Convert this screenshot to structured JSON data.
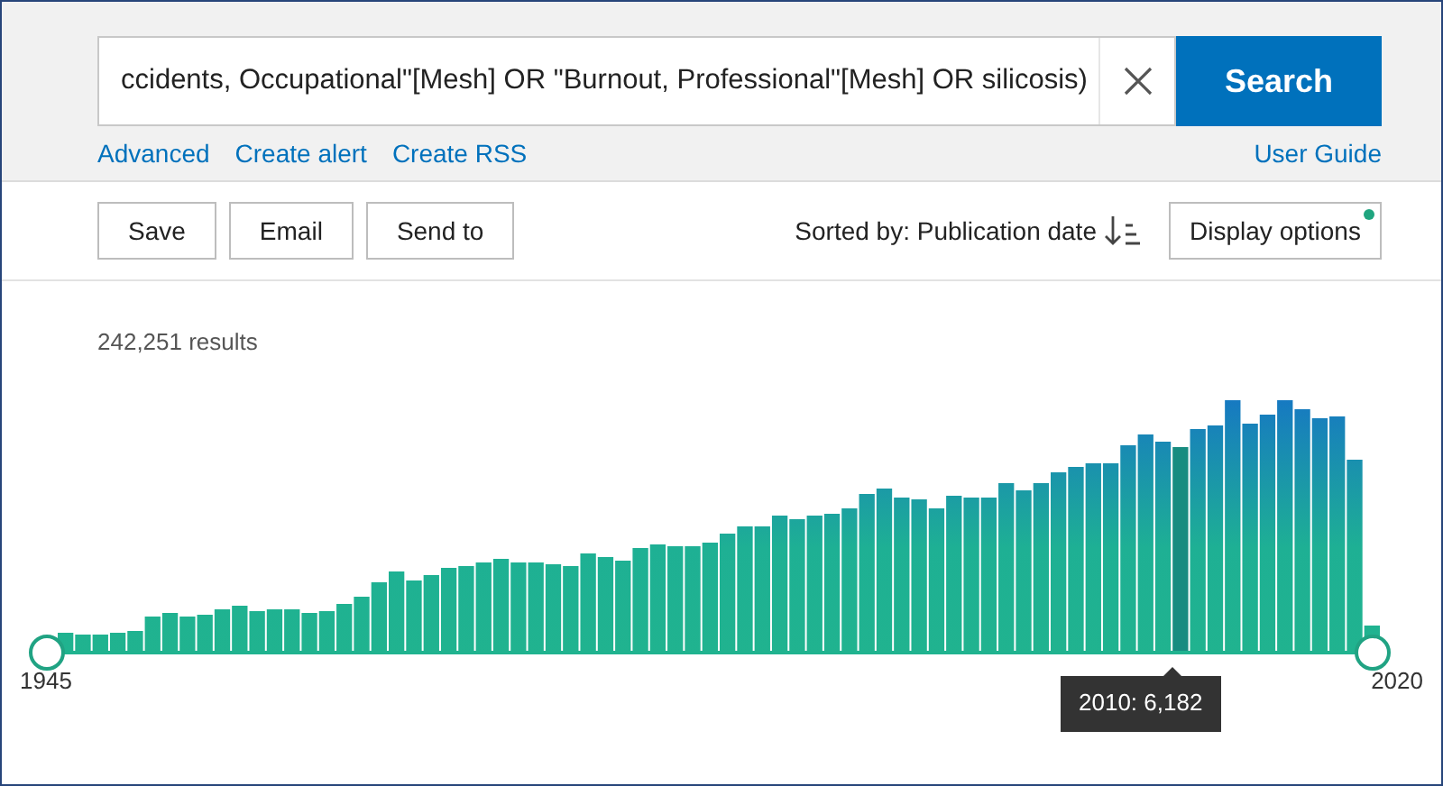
{
  "search": {
    "value": "ccidents, Occupational\"[Mesh] OR \"Burnout, Professional\"[Mesh] OR silicosis)",
    "button": "Search"
  },
  "links": [
    "Advanced",
    "Create alert",
    "Create RSS"
  ],
  "help_link": "User Guide",
  "actions": [
    "Save",
    "Email",
    "Send to"
  ],
  "sort": {
    "label": "Sorted by: Publication date"
  },
  "display_options": {
    "label": "Display options",
    "indicator": true
  },
  "results": "242,251 results",
  "timeline": {
    "start_label": "1945",
    "end_label": "2020",
    "tooltip": "2010: 6,182"
  }
}
